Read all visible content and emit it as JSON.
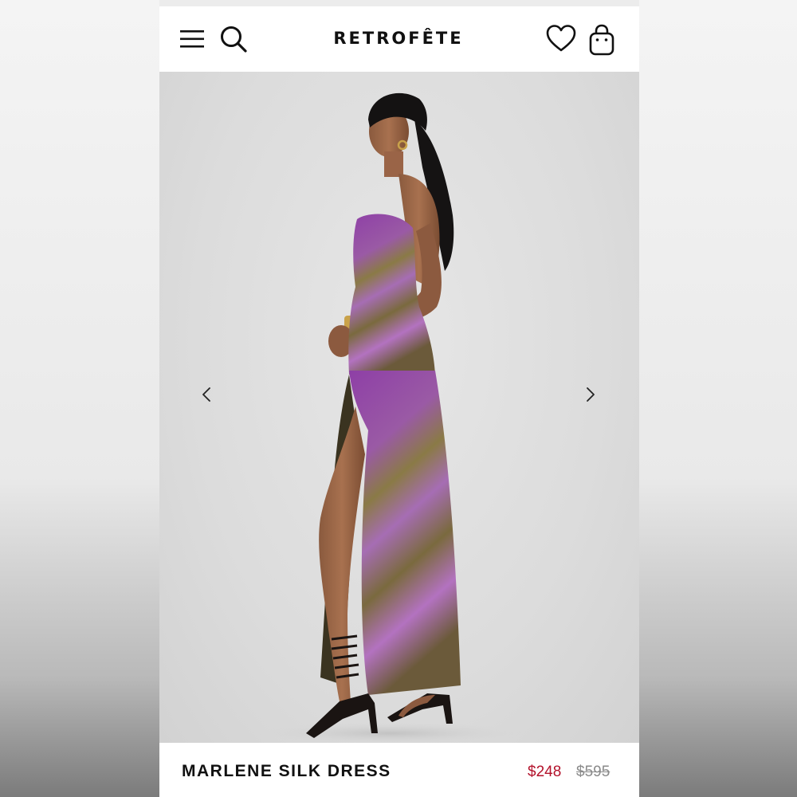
{
  "header": {
    "brand": "RETROFÊTE",
    "icons": [
      "menu-icon",
      "search-icon",
      "heart-icon",
      "shopping-bag-icon"
    ]
  },
  "gallery": {
    "prev_icon": "chevron-left-icon",
    "next_icon": "chevron-right-icon"
  },
  "product": {
    "name": "MARLENE SILK DRESS",
    "sale_price": "$248",
    "original_price": "$595"
  },
  "colors": {
    "sale_price": "#b3122b",
    "original_price": "#8a8a8a",
    "text": "#111111",
    "photo_background": "#dcdcdc",
    "dress_purple": "#8e3fa6",
    "dress_olive": "#6f6a2e"
  }
}
